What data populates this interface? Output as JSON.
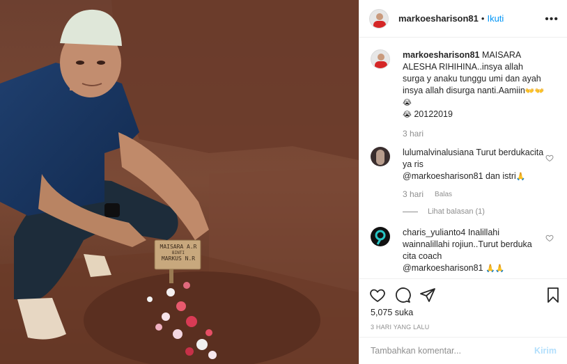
{
  "post": {
    "username": "markoesharison81",
    "separator": "•",
    "follow_label": "Ikuti",
    "more_label": "•••"
  },
  "photo": {
    "sign_line1": "MAISARA A.R",
    "sign_line2": "BINTI",
    "sign_line3": "MARKUS N.R"
  },
  "caption": {
    "username": "markoesharison81",
    "text": "MAISARA ALESHA RIHIHINA..insya allah surga y anaku tunggu umi dan ayah insya allah disurga nanti.Aamiin",
    "emojis": "👐👐😭",
    "emoji2": "😭",
    "date_text": "20122019",
    "time": "3 hari"
  },
  "comments": [
    {
      "username": "lulumalvinalusiana",
      "text": "Turut berdukacita ya ris",
      "mention": "@markoesharison81",
      "suffix": "dan istri",
      "suffix_emoji": "🙏",
      "time": "3 hari",
      "reply_label": "Balas",
      "view_replies": "Lihat balasan (1)"
    },
    {
      "username": "charis_yulianto4",
      "text": "Inalillahi wainnalillahi rojiun..Turut berduka cita coach",
      "mention": "@markoesharison81",
      "suffix_emoji": "🙏🙏"
    }
  ],
  "likes": "5,075 suka",
  "date_ago": "3 HARI YANG LALU",
  "add_comment": {
    "placeholder": "Tambahkan komentar...",
    "post_label": "Kirim"
  },
  "colors": {
    "link": "#0095f6",
    "muted": "#8e8e8e",
    "text": "#262626",
    "soil": "#5e3526"
  },
  "icons": [
    "heart-icon",
    "comment-icon",
    "share-icon",
    "bookmark-icon",
    "more-icon"
  ]
}
